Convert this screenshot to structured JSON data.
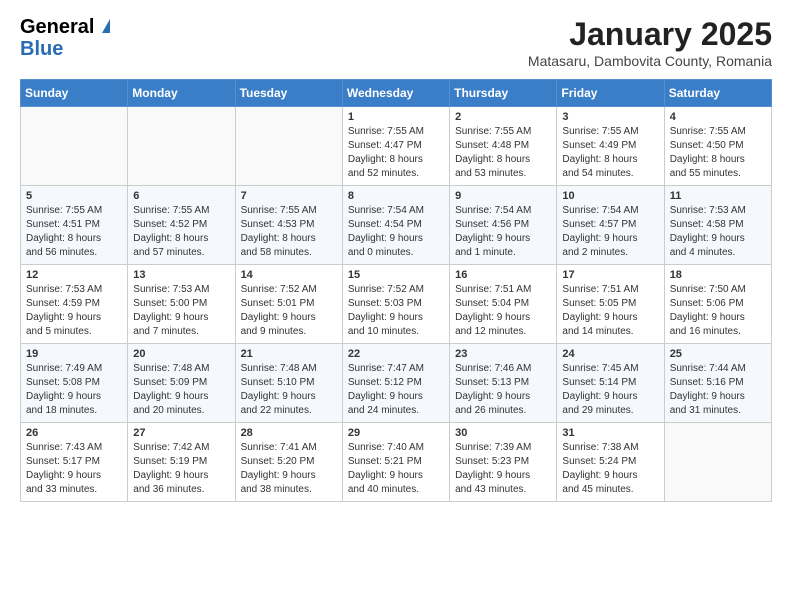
{
  "header": {
    "logo_line1": "General",
    "logo_line2": "Blue",
    "month_title": "January 2025",
    "location": "Matasaru, Dambovita County, Romania"
  },
  "weekdays": [
    "Sunday",
    "Monday",
    "Tuesday",
    "Wednesday",
    "Thursday",
    "Friday",
    "Saturday"
  ],
  "weeks": [
    [
      {
        "day": "",
        "info": ""
      },
      {
        "day": "",
        "info": ""
      },
      {
        "day": "",
        "info": ""
      },
      {
        "day": "1",
        "info": "Sunrise: 7:55 AM\nSunset: 4:47 PM\nDaylight: 8 hours\nand 52 minutes."
      },
      {
        "day": "2",
        "info": "Sunrise: 7:55 AM\nSunset: 4:48 PM\nDaylight: 8 hours\nand 53 minutes."
      },
      {
        "day": "3",
        "info": "Sunrise: 7:55 AM\nSunset: 4:49 PM\nDaylight: 8 hours\nand 54 minutes."
      },
      {
        "day": "4",
        "info": "Sunrise: 7:55 AM\nSunset: 4:50 PM\nDaylight: 8 hours\nand 55 minutes."
      }
    ],
    [
      {
        "day": "5",
        "info": "Sunrise: 7:55 AM\nSunset: 4:51 PM\nDaylight: 8 hours\nand 56 minutes."
      },
      {
        "day": "6",
        "info": "Sunrise: 7:55 AM\nSunset: 4:52 PM\nDaylight: 8 hours\nand 57 minutes."
      },
      {
        "day": "7",
        "info": "Sunrise: 7:55 AM\nSunset: 4:53 PM\nDaylight: 8 hours\nand 58 minutes."
      },
      {
        "day": "8",
        "info": "Sunrise: 7:54 AM\nSunset: 4:54 PM\nDaylight: 9 hours\nand 0 minutes."
      },
      {
        "day": "9",
        "info": "Sunrise: 7:54 AM\nSunset: 4:56 PM\nDaylight: 9 hours\nand 1 minute."
      },
      {
        "day": "10",
        "info": "Sunrise: 7:54 AM\nSunset: 4:57 PM\nDaylight: 9 hours\nand 2 minutes."
      },
      {
        "day": "11",
        "info": "Sunrise: 7:53 AM\nSunset: 4:58 PM\nDaylight: 9 hours\nand 4 minutes."
      }
    ],
    [
      {
        "day": "12",
        "info": "Sunrise: 7:53 AM\nSunset: 4:59 PM\nDaylight: 9 hours\nand 5 minutes."
      },
      {
        "day": "13",
        "info": "Sunrise: 7:53 AM\nSunset: 5:00 PM\nDaylight: 9 hours\nand 7 minutes."
      },
      {
        "day": "14",
        "info": "Sunrise: 7:52 AM\nSunset: 5:01 PM\nDaylight: 9 hours\nand 9 minutes."
      },
      {
        "day": "15",
        "info": "Sunrise: 7:52 AM\nSunset: 5:03 PM\nDaylight: 9 hours\nand 10 minutes."
      },
      {
        "day": "16",
        "info": "Sunrise: 7:51 AM\nSunset: 5:04 PM\nDaylight: 9 hours\nand 12 minutes."
      },
      {
        "day": "17",
        "info": "Sunrise: 7:51 AM\nSunset: 5:05 PM\nDaylight: 9 hours\nand 14 minutes."
      },
      {
        "day": "18",
        "info": "Sunrise: 7:50 AM\nSunset: 5:06 PM\nDaylight: 9 hours\nand 16 minutes."
      }
    ],
    [
      {
        "day": "19",
        "info": "Sunrise: 7:49 AM\nSunset: 5:08 PM\nDaylight: 9 hours\nand 18 minutes."
      },
      {
        "day": "20",
        "info": "Sunrise: 7:48 AM\nSunset: 5:09 PM\nDaylight: 9 hours\nand 20 minutes."
      },
      {
        "day": "21",
        "info": "Sunrise: 7:48 AM\nSunset: 5:10 PM\nDaylight: 9 hours\nand 22 minutes."
      },
      {
        "day": "22",
        "info": "Sunrise: 7:47 AM\nSunset: 5:12 PM\nDaylight: 9 hours\nand 24 minutes."
      },
      {
        "day": "23",
        "info": "Sunrise: 7:46 AM\nSunset: 5:13 PM\nDaylight: 9 hours\nand 26 minutes."
      },
      {
        "day": "24",
        "info": "Sunrise: 7:45 AM\nSunset: 5:14 PM\nDaylight: 9 hours\nand 29 minutes."
      },
      {
        "day": "25",
        "info": "Sunrise: 7:44 AM\nSunset: 5:16 PM\nDaylight: 9 hours\nand 31 minutes."
      }
    ],
    [
      {
        "day": "26",
        "info": "Sunrise: 7:43 AM\nSunset: 5:17 PM\nDaylight: 9 hours\nand 33 minutes."
      },
      {
        "day": "27",
        "info": "Sunrise: 7:42 AM\nSunset: 5:19 PM\nDaylight: 9 hours\nand 36 minutes."
      },
      {
        "day": "28",
        "info": "Sunrise: 7:41 AM\nSunset: 5:20 PM\nDaylight: 9 hours\nand 38 minutes."
      },
      {
        "day": "29",
        "info": "Sunrise: 7:40 AM\nSunset: 5:21 PM\nDaylight: 9 hours\nand 40 minutes."
      },
      {
        "day": "30",
        "info": "Sunrise: 7:39 AM\nSunset: 5:23 PM\nDaylight: 9 hours\nand 43 minutes."
      },
      {
        "day": "31",
        "info": "Sunrise: 7:38 AM\nSunset: 5:24 PM\nDaylight: 9 hours\nand 45 minutes."
      },
      {
        "day": "",
        "info": ""
      }
    ]
  ]
}
